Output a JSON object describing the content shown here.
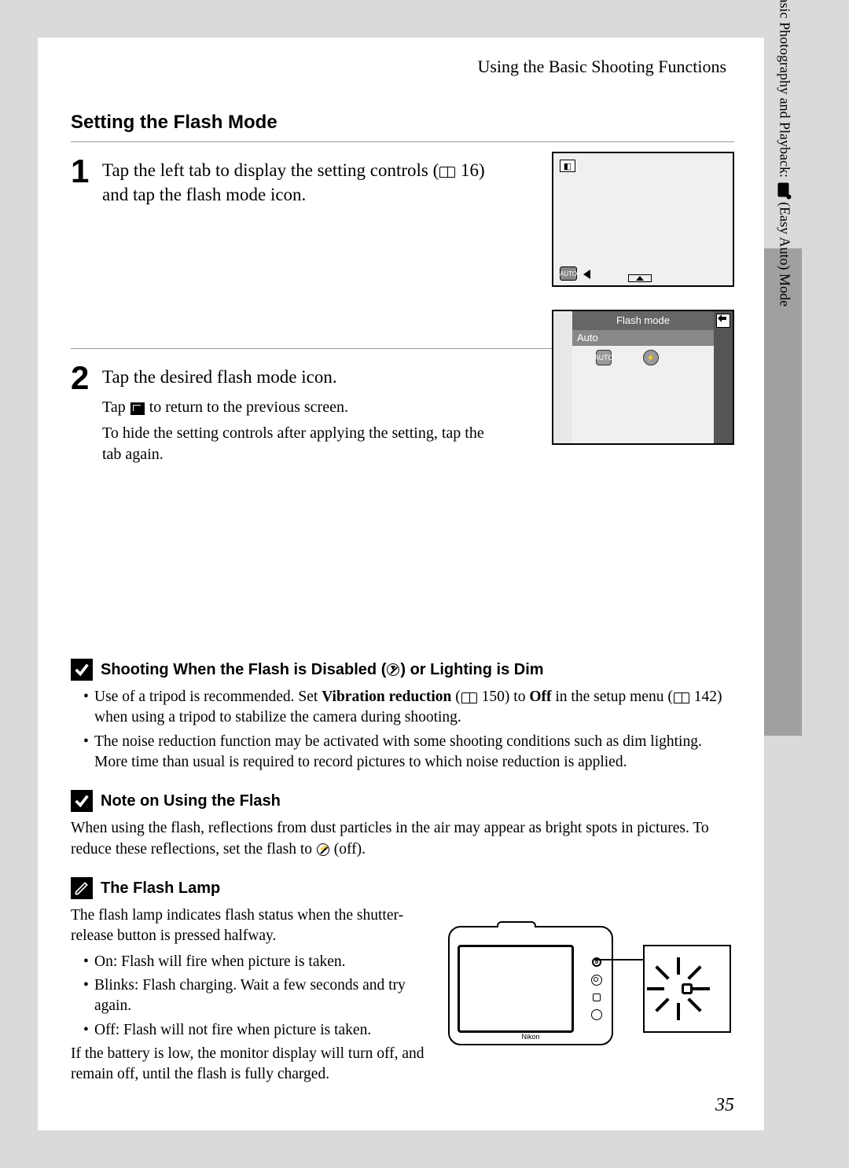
{
  "header": "Using the Basic Shooting Functions",
  "section_title": "Setting the Flash Mode",
  "side_tab_label_prefix": "Basic Photography and Playback: ",
  "side_tab_label_suffix": " (Easy Auto) Mode",
  "steps": [
    {
      "num": "1",
      "main_a": "Tap the left tab to display the setting controls (",
      "main_b": " 16) and tap the flash mode icon.",
      "sub": []
    },
    {
      "num": "2",
      "main_a": "Tap the desired flash mode icon.",
      "sub": [
        {
          "pre": "Tap ",
          "post": " to return to the previous screen.",
          "icon": "return"
        },
        {
          "text": "To hide the setting controls after applying the setting, tap the tab again."
        }
      ]
    }
  ],
  "screen1": {
    "auto_icon_label": "AUTO"
  },
  "screen2": {
    "title": "Flash mode",
    "selected": "Auto",
    "icon1": "AUTO"
  },
  "notes": {
    "n1_title_a": "Shooting When the Flash is Disabled (",
    "n1_title_b": ") or Lighting is Dim",
    "n1_bullets": [
      {
        "pre": "Use of a tripod is recommended. Set ",
        "bold1": "Vibration reduction",
        "mid1": " (",
        "pageref1": " 150) to ",
        "bold2": "Off",
        "mid2": " in the setup menu (",
        "pageref2": " 142) when using a tripod to stabilize the camera during shooting."
      },
      {
        "text": "The noise reduction function may be activated with some shooting conditions such as dim lighting. More time than usual is required to record pictures to which noise reduction is applied."
      }
    ],
    "n2_title": "Note on Using the Flash",
    "n2_body_a": "When using the flash, reflections from dust particles in the air may appear as bright spots in pictures. To reduce these reflections, set the flash to ",
    "n2_body_b": " (off).",
    "n3_title": "The Flash Lamp",
    "n3_intro": "The flash lamp indicates flash status when the shutter-release button is pressed halfway.",
    "n3_bullets": [
      "On: Flash will fire when picture is taken.",
      "Blinks: Flash charging. Wait a few seconds and try again.",
      "Off: Flash will not fire when picture is taken."
    ],
    "n3_outro": "If the battery is low, the monitor display will turn off, and remain off, until the flash is fully charged."
  },
  "camera_label": "Nikon",
  "page_number": "35"
}
